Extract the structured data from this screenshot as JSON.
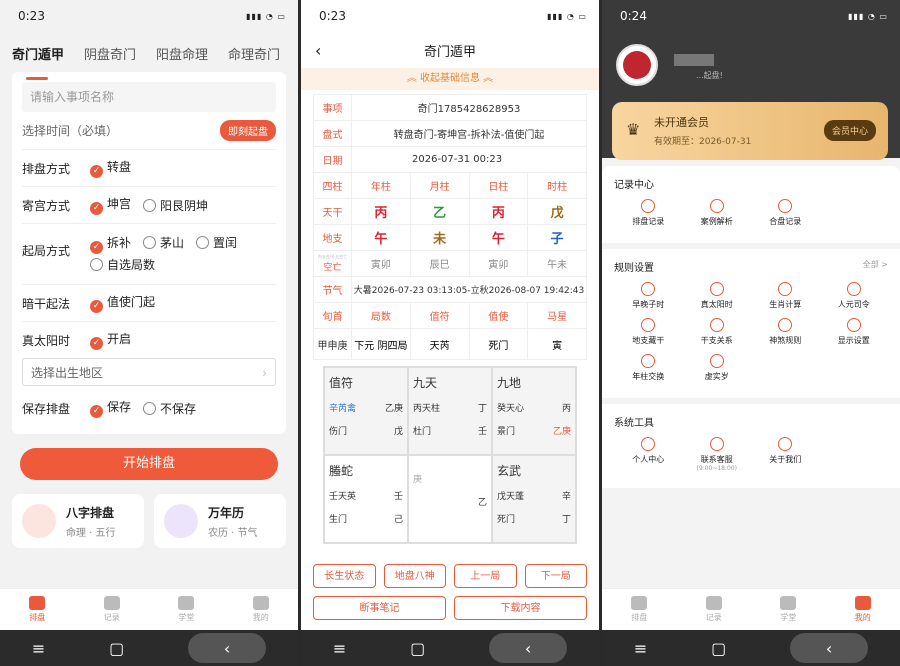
{
  "status": {
    "p1": "0:23",
    "p2": "0:23",
    "p3": "0:24"
  },
  "p1": {
    "tabs": [
      "奇门遁甲",
      "阴盘奇门",
      "阳盘命理",
      "命理奇门"
    ],
    "name_placeholder": "请输入事项名称",
    "time_label": "选择时间（必填）",
    "time_btn": "即刻起盘",
    "rows": [
      {
        "label": "排盘方式",
        "opts": [
          {
            "t": "转盘",
            "on": true
          }
        ]
      },
      {
        "label": "寄宫方式",
        "opts": [
          {
            "t": "坤宫",
            "on": true
          },
          {
            "t": "阳艮阴坤",
            "on": false
          }
        ]
      },
      {
        "label": "起局方式",
        "opts": [
          {
            "t": "拆补",
            "on": true
          },
          {
            "t": "茅山",
            "on": false
          },
          {
            "t": "置闰",
            "on": false
          },
          {
            "t": "自选局数",
            "on": false
          }
        ]
      },
      {
        "label": "暗干起法",
        "opts": [
          {
            "t": "值使门起",
            "on": true
          }
        ]
      },
      {
        "label": "真太阳时",
        "opts": [
          {
            "t": "开启",
            "on": true
          }
        ]
      }
    ],
    "region_placeholder": "选择出生地区",
    "save_label": "保存排盘",
    "save_opts": [
      {
        "t": "保存",
        "on": true
      },
      {
        "t": "不保存",
        "on": false
      }
    ],
    "start_btn": "开始排盘",
    "tiles": [
      {
        "t": "八字排盘",
        "s": "命理 · 五行"
      },
      {
        "t": "万年历",
        "s": "农历 · 节气"
      }
    ]
  },
  "tabbar": [
    "排盘",
    "记录",
    "学堂",
    "我的"
  ],
  "p2": {
    "title": "奇门遁甲",
    "collapse": "︽ 收起基础信息 ︽",
    "info": [
      {
        "k": "事项",
        "v": "奇门1785428628953"
      },
      {
        "k": "盘式",
        "v": "转盘奇门-寄坤宫-拆补法-值使门起"
      },
      {
        "k": "日期",
        "v": "2026-07-31 00:23"
      }
    ],
    "pillars": {
      "k": "四柱",
      "cols": [
        "年柱",
        "月柱",
        "日柱",
        "时柱"
      ]
    },
    "gan": {
      "k": "天干",
      "cols": [
        "丙",
        "乙",
        "丙",
        "戊"
      ]
    },
    "zhi": {
      "k": "地支",
      "cols": [
        "午",
        "未",
        "午",
        "子"
      ]
    },
    "kong": {
      "k": "空亡",
      "kpre": "内五合/外五空亡",
      "cols": [
        "寅卯",
        "辰巳",
        "寅卯",
        "午未"
      ]
    },
    "jieqi": {
      "k": "节气",
      "v": "大暑2026-07-23 03:13:05-立秋2026-08-07 19:42:43"
    },
    "xun_head": {
      "k": "旬首",
      "cols": [
        "局数",
        "值符",
        "值使",
        "马星"
      ]
    },
    "xun": {
      "k": "甲申庚",
      "cols": [
        "下元 阴四局",
        "天芮",
        "死门",
        "寅"
      ]
    },
    "cells": [
      {
        "god": "值符",
        "a": "辛芮禽",
        "ar": "乙庚",
        "b": "伤门",
        "br": "戊"
      },
      {
        "god": "九天",
        "a": "丙天柱",
        "ar": "丁",
        "b": "杜门",
        "br": "壬"
      },
      {
        "god": "九地",
        "a": "癸天心",
        "ar": "丙",
        "b": "景门",
        "br": "乙庚"
      },
      {
        "god": "螣蛇",
        "a": "壬天英",
        "ar": "壬",
        "b": "生门",
        "br": "己"
      },
      {
        "god": "",
        "a": "庚",
        "ar": "",
        "b": "",
        "br": "乙"
      },
      {
        "god": "玄武",
        "a": "戊天蓬",
        "ar": "辛",
        "b": "死门",
        "br": "丁"
      }
    ],
    "btns1": [
      "长生状态",
      "地盘八神",
      "上一局",
      "下一局"
    ],
    "btns2": [
      "断事笔记",
      "下载内容"
    ]
  },
  "p3": {
    "user_sub": "...起盘!",
    "vip_title": "未开通会员",
    "vip_sub": "有效期至：2026-07-31",
    "vip_btn": "会员中心",
    "s1": {
      "title": "记录中心",
      "items": [
        "排盘记录",
        "案例解析",
        "合盘记录"
      ]
    },
    "s2": {
      "title": "规则设置",
      "more": "全部 >",
      "items": [
        "早晚子时",
        "真太阳时",
        "生肖计算",
        "人元司令",
        "地支藏干",
        "干支关系",
        "神煞规则",
        "显示设置",
        "年柱交换",
        "虚实岁"
      ]
    },
    "s3": {
      "title": "系统工具",
      "items": [
        "个人中心",
        "联系客服",
        "关于我们"
      ],
      "hours": "(9:00~18:00)"
    }
  }
}
